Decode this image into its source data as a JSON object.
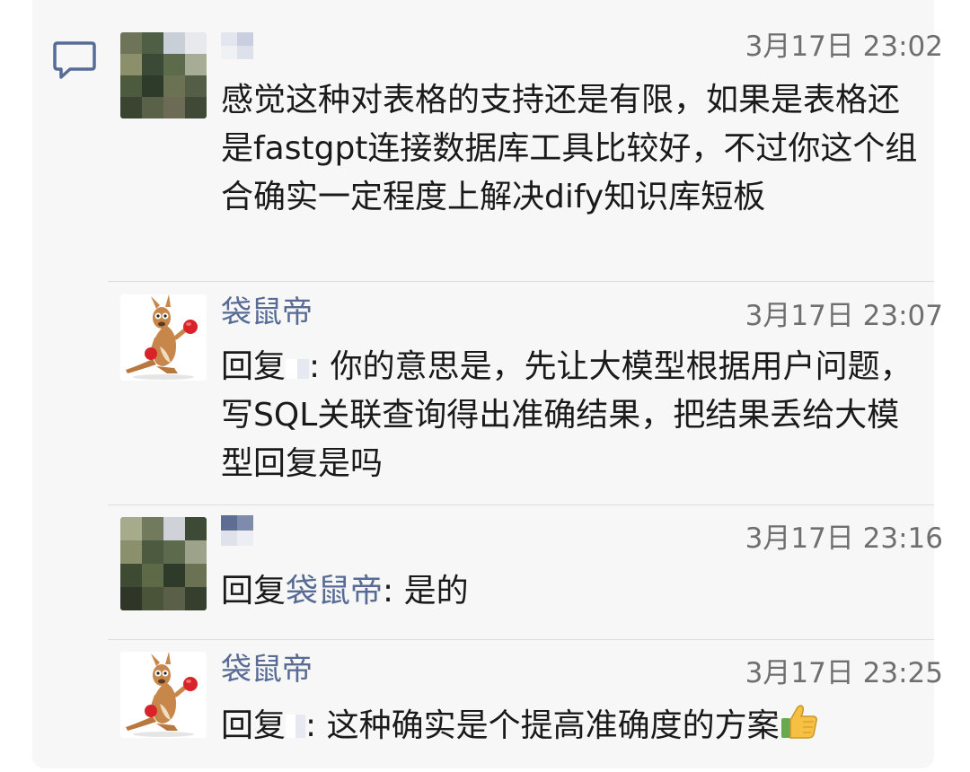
{
  "comments": [
    {
      "name": "",
      "time": "3月17日 23:02",
      "text": "感觉这种对表格的支持还是有限，如果是表格还是fastgpt连接数据库工具比较好，不过你这个组合确实一定程度上解决dify知识库短板"
    },
    {
      "name": "袋鼠帝",
      "time": "3月17日 23:07",
      "reply_prefix": "回复",
      "reply_target": "",
      "text": ": 你的意思是，先让大模型根据用户问题，写SQL关联查询得出准确结果，把结果丢给大模型回复是吗"
    },
    {
      "name": "",
      "time": "3月17日 23:16",
      "reply_prefix": "回复",
      "reply_target": "袋鼠帝",
      "text": ": 是的"
    },
    {
      "name": "袋鼠帝",
      "time": "3月17日 23:25",
      "reply_prefix": "回复",
      "reply_target": "",
      "text": ": 这种确实是个提高准确度的方案",
      "emoji": "thumbs-up-icon"
    }
  ],
  "colors": {
    "name_link": "#576b95",
    "timestamp": "#6f6f6f",
    "body_text": "#1a1a1a",
    "panel_bg": "#f7f7f7"
  }
}
